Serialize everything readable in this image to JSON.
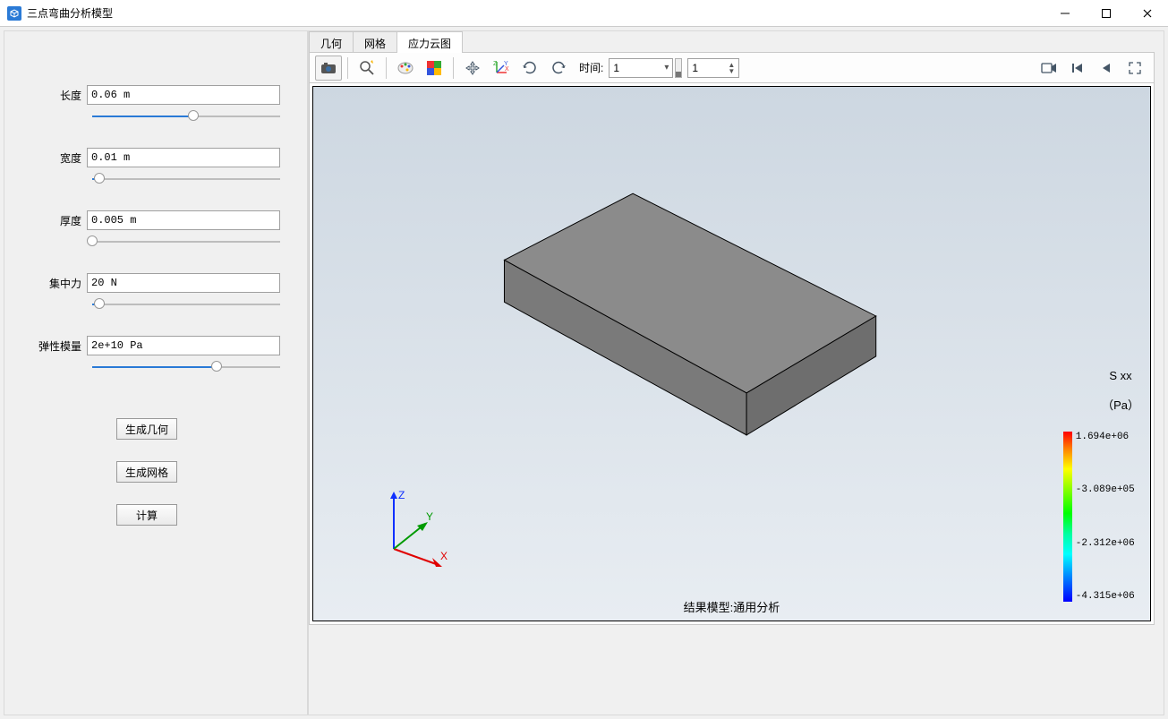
{
  "window": {
    "title": "三点弯曲分析模型"
  },
  "params": {
    "length": {
      "label": "长度",
      "value": "0.06 m",
      "slider_pct": 54
    },
    "width": {
      "label": "宽度",
      "value": "0.01 m",
      "slider_pct": 4
    },
    "thick": {
      "label": "厚度",
      "value": "0.005 m",
      "slider_pct": 0
    },
    "force": {
      "label": "集中力",
      "value": "20 N",
      "slider_pct": 4
    },
    "young": {
      "label": "弹性模量",
      "value": "2e+10 Pa",
      "slider_pct": 66
    }
  },
  "buttons": {
    "gen_geom": "生成几何",
    "gen_mesh": "生成网格",
    "compute": "计算"
  },
  "tabs": {
    "geom": "几何",
    "mesh": "网格",
    "stress": "应力云图",
    "selected": "stress"
  },
  "toolbar": {
    "time_label": "时间:",
    "time_combo_value": "1",
    "frame_spin_value": "1"
  },
  "viewport": {
    "caption_prefix": "结果模型:",
    "caption_value": "通用分析"
  },
  "legend": {
    "title_line1": "S xx",
    "title_line2": "（Pa）",
    "ticks": [
      "1.694e+06",
      "-3.089e+05",
      "-2.312e+06",
      "-4.315e+06"
    ]
  },
  "triad": {
    "x": "X",
    "y": "Y",
    "z": "Z"
  }
}
